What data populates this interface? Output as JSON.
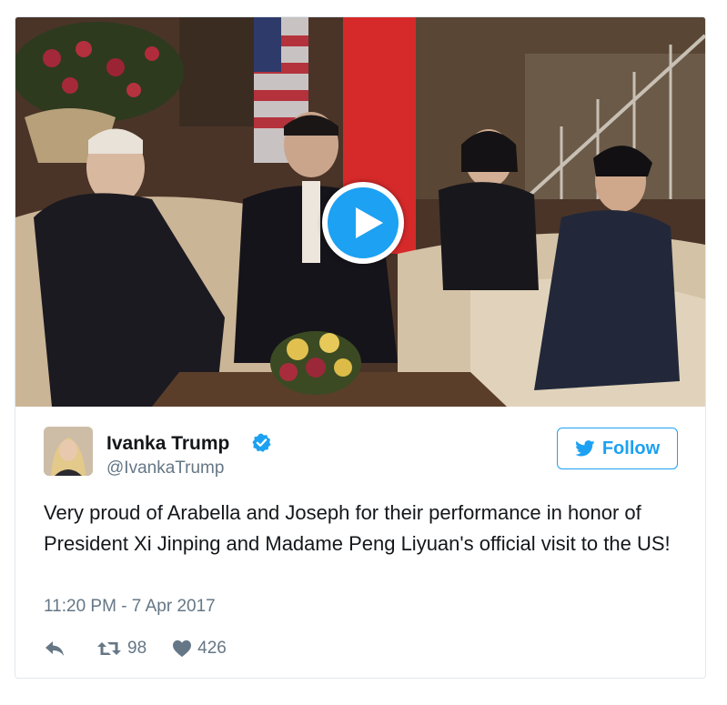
{
  "tweet": {
    "author_name": "Ivanka Trump",
    "handle": "@IvankaTrump",
    "follow_label": "Follow",
    "text": "Very proud of Arabella and Joseph for their performance in honor of President Xi Jinping and Madame Peng Liyuan's official visit to the US!",
    "timestamp": "11:20 PM - 7 Apr 2017",
    "retweet_count": "98",
    "like_count": "426"
  },
  "colors": {
    "accent": "#1da1f2",
    "secondary_text": "#657786",
    "primary_text": "#14171a",
    "border": "#e1e8ed"
  },
  "icons": {
    "reply": "reply-arrow-icon",
    "retweet": "retweet-icon",
    "like": "heart-icon",
    "verified": "verified-badge-icon",
    "follow": "twitter-bird-icon",
    "play": "play-icon"
  }
}
